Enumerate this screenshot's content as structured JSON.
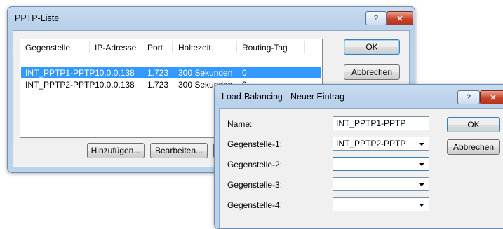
{
  "pptp_window": {
    "title": "PPTP-Liste",
    "help_glyph": "?",
    "close_glyph": "✕",
    "columns": [
      "Gegenstelle",
      "IP-Adresse",
      "Port",
      "Haltezeit",
      "Routing-Tag"
    ],
    "rows": [
      [
        "INT_PPTP1-PPTP",
        "10.0.0.138",
        "1.723",
        "300 Sekunden",
        "0"
      ],
      [
        "INT_PPTP2-PPTP",
        "10.0.0.138",
        "1.723",
        "300 Sekunden",
        "0"
      ]
    ],
    "ok_label": "OK",
    "cancel_label": "Abbrechen",
    "add_label": "Hinzufügen...",
    "edit_label": "Bearbeiten..."
  },
  "lb_dialog": {
    "title": "Load-Balancing - Neuer Eintrag",
    "help_glyph": "?",
    "close_glyph": "✕",
    "name_label": "Name:",
    "name_value": "INT_PPTP1-PPTP",
    "peer1_label": "Gegenstelle-1:",
    "peer1_value": "INT_PPTP2-PPTP",
    "peer2_label": "Gegenstelle-2:",
    "peer2_value": "",
    "peer3_label": "Gegenstelle-3:",
    "peer3_value": "",
    "peer4_label": "Gegenstelle-4:",
    "peer4_value": "",
    "ok_label": "OK",
    "cancel_label": "Abbrechen"
  }
}
